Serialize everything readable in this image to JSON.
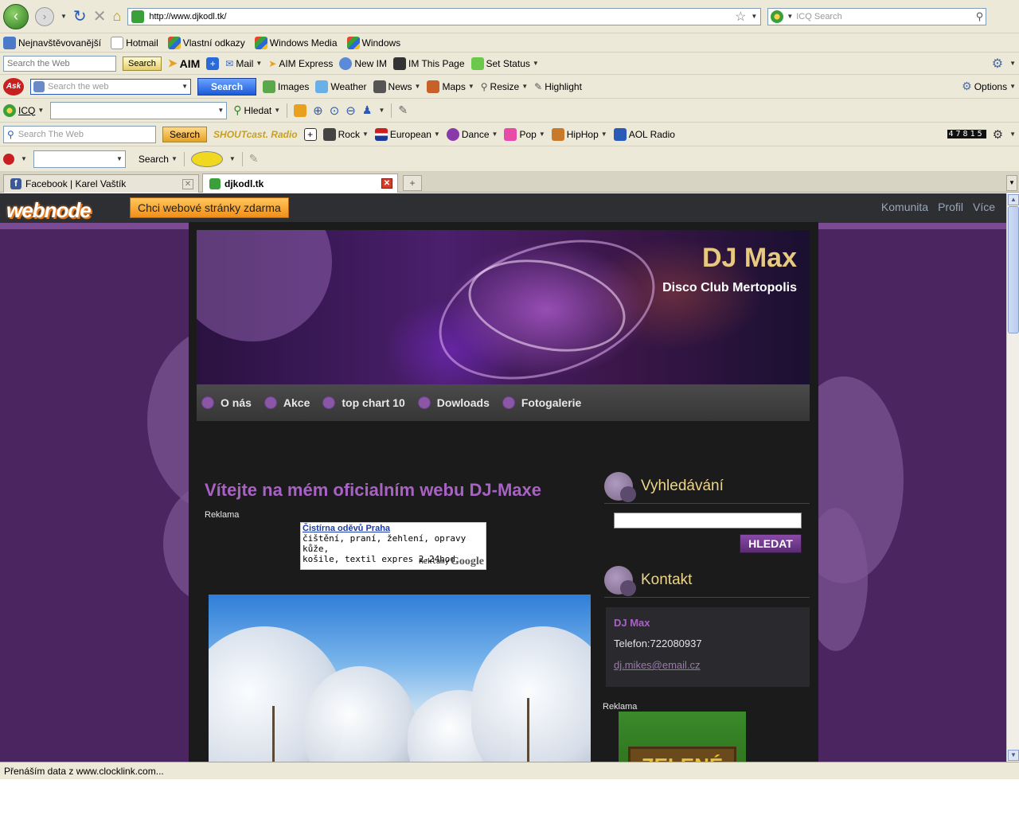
{
  "browser": {
    "url": "http://www.djkodl.tk/",
    "search_placeholder": "ICQ Search",
    "bookmarks": [
      "Nejnavštěvovanější",
      "Hotmail",
      "Vlastní odkazy",
      "Windows Media",
      "Windows"
    ],
    "aim_toolbar": {
      "search_placeholder": "Search the Web",
      "search_button": "Search",
      "brand": "AIM",
      "items": [
        "Mail",
        "AIM Express",
        "New IM",
        "IM This Page",
        "Set Status"
      ]
    },
    "ask_toolbar": {
      "search_placeholder": "Search the web",
      "search_button": "Search",
      "items": [
        "Images",
        "Weather",
        "News",
        "Maps",
        "Resize",
        "Highlight"
      ],
      "options": "Options"
    },
    "icq_toolbar": {
      "label": "ICQ",
      "find": "Hledat"
    },
    "radio_toolbar": {
      "search_placeholder": "Search The Web",
      "search_button": "Search",
      "brand": "SHOUTcast. Radio",
      "items": [
        "Rock",
        "European",
        "Dance",
        "Pop",
        "HipHop",
        "AOL Radio"
      ],
      "counter": "47815"
    },
    "misc_toolbar": {
      "search": "Search"
    },
    "tabs": [
      {
        "label": "Facebook | Karel Vaštík",
        "active": false
      },
      {
        "label": "djkodl.tk",
        "active": true
      }
    ],
    "status": "Přenáším data z www.clocklink.com..."
  },
  "webnode": {
    "logo": "webnode",
    "cta": "Chci webové stránky zdarma",
    "nav": [
      "Komunita",
      "Profil",
      "Více"
    ]
  },
  "site": {
    "title": "DJ Max",
    "subtitle": "Disco Club Mertopolis",
    "menu": [
      "O nás",
      "Akce",
      "top chart 10",
      "Dowloads",
      "Fotogalerie"
    ],
    "main_title": "Vítejte na mém oficialním webu DJ-Maxe",
    "ad_label": "Reklama",
    "ad": {
      "title": "Čistírna oděvů Praha",
      "line1": "čištění, praní, žehlení, opravy kůže,",
      "line2": "košile, textil expres 2-24hod",
      "footer": "Reklamy",
      "footer_brand": "Google"
    },
    "sidebar": {
      "search_title": "Vyhledávání",
      "search_button": "HLEDAT",
      "contact_title": "Kontakt",
      "contact_name": "DJ Max",
      "contact_phone": "Telefon:722080937",
      "contact_email": "dj.mikes@email.cz",
      "ad_label": "Reklama",
      "ad_sign": "ZELENÉ"
    }
  }
}
